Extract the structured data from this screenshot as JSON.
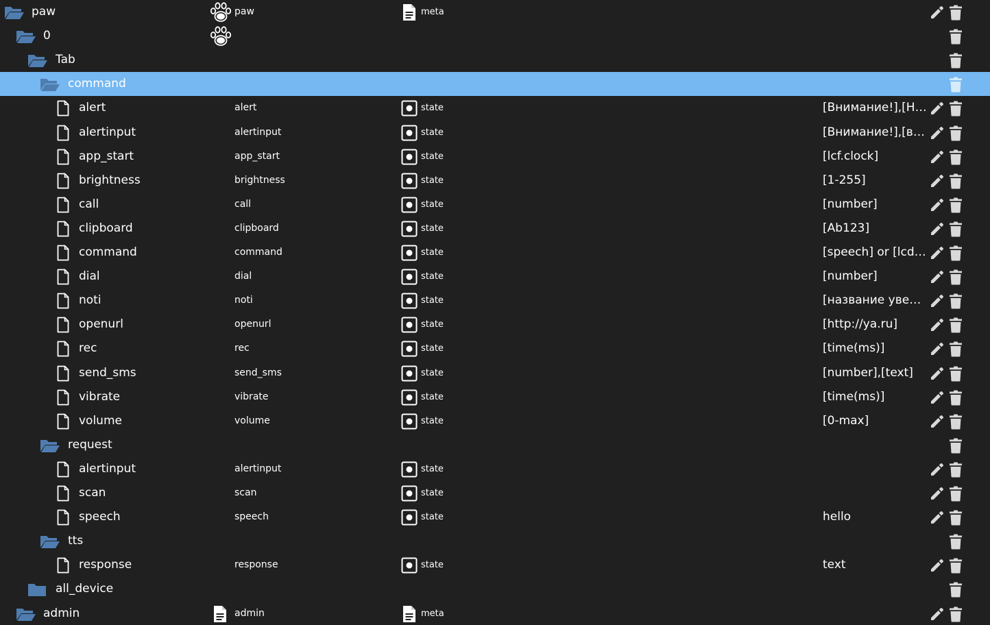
{
  "tree": [
    {
      "type": "folder",
      "open": true,
      "depth": 0,
      "name": "paw",
      "common_icon": "paw-icon",
      "common_name": "paw",
      "role_icon": "file-text-icon",
      "role": "meta",
      "edit": true
    },
    {
      "type": "folder",
      "open": true,
      "depth": 1,
      "name": "0",
      "common_icon": "paw-icon",
      "common_name": "",
      "role": "",
      "edit": false
    },
    {
      "type": "folder",
      "open": true,
      "depth": 2,
      "name": "Tab",
      "role": "",
      "edit": false
    },
    {
      "type": "folder",
      "open": true,
      "depth": 3,
      "name": "command",
      "role": "",
      "edit": false,
      "selected": true
    },
    {
      "type": "state",
      "depth": 4,
      "name": "alert",
      "common_name": "alert",
      "role_icon": "state-icon",
      "role": "state",
      "value": "[Внимание!],[Нет соединения]",
      "edit": true
    },
    {
      "type": "state",
      "depth": 4,
      "name": "alertinput",
      "common_name": "alertinput",
      "role_icon": "state-icon",
      "role": "state",
      "value": "[Внимание!],[введите текст]",
      "edit": true
    },
    {
      "type": "state",
      "depth": 4,
      "name": "app_start",
      "common_name": "app_start",
      "role_icon": "state-icon",
      "role": "state",
      "value": "[lcf.clock]",
      "edit": true
    },
    {
      "type": "state",
      "depth": 4,
      "name": "brightness",
      "common_name": "brightness",
      "role_icon": "state-icon",
      "role": "state",
      "value": "[1-255]",
      "edit": true
    },
    {
      "type": "state",
      "depth": 4,
      "name": "call",
      "common_name": "call",
      "role_icon": "state-icon",
      "role": "state",
      "value": "[number]",
      "edit": true
    },
    {
      "type": "state",
      "depth": 4,
      "name": "clipboard",
      "common_name": "clipboard",
      "role_icon": "state-icon",
      "role": "state",
      "value": "[Ab123]",
      "edit": true
    },
    {
      "type": "state",
      "depth": 4,
      "name": "command",
      "common_name": "command",
      "role_icon": "state-icon",
      "role": "state",
      "value": "[speech] or [lcd_on]",
      "edit": true
    },
    {
      "type": "state",
      "depth": 4,
      "name": "dial",
      "common_name": "dial",
      "role_icon": "state-icon",
      "role": "state",
      "value": "[number]",
      "edit": true
    },
    {
      "type": "state",
      "depth": 4,
      "name": "noti",
      "common_name": "noti",
      "role_icon": "state-icon",
      "role": "state",
      "value": "[название увед.],[текст]",
      "edit": true
    },
    {
      "type": "state",
      "depth": 4,
      "name": "openurl",
      "common_name": "openurl",
      "role_icon": "state-icon",
      "role": "state",
      "value": "[http://ya.ru]",
      "edit": true
    },
    {
      "type": "state",
      "depth": 4,
      "name": "rec",
      "common_name": "rec",
      "role_icon": "state-icon",
      "role": "state",
      "value": "[time(ms)]",
      "edit": true
    },
    {
      "type": "state",
      "depth": 4,
      "name": "send_sms",
      "common_name": "send_sms",
      "role_icon": "state-icon",
      "role": "state",
      "value": "[number],[text]",
      "edit": true
    },
    {
      "type": "state",
      "depth": 4,
      "name": "vibrate",
      "common_name": "vibrate",
      "role_icon": "state-icon",
      "role": "state",
      "value": "[time(ms)]",
      "edit": true
    },
    {
      "type": "state",
      "depth": 4,
      "name": "volume",
      "common_name": "volume",
      "role_icon": "state-icon",
      "role": "state",
      "value": "[0-max]",
      "edit": true
    },
    {
      "type": "folder",
      "open": true,
      "depth": 3,
      "name": "request",
      "role": "",
      "edit": false
    },
    {
      "type": "state",
      "depth": 4,
      "name": "alertinput",
      "common_name": "alertinput",
      "role_icon": "state-icon",
      "role": "state",
      "value": "",
      "edit": true
    },
    {
      "type": "state",
      "depth": 4,
      "name": "scan",
      "common_name": "scan",
      "role_icon": "state-icon",
      "role": "state",
      "value": "",
      "edit": true
    },
    {
      "type": "state",
      "depth": 4,
      "name": "speech",
      "common_name": "speech",
      "role_icon": "state-icon",
      "role": "state",
      "value": "hello",
      "edit": true
    },
    {
      "type": "folder",
      "open": true,
      "depth": 3,
      "name": "tts",
      "role": "",
      "edit": false
    },
    {
      "type": "state",
      "depth": 4,
      "name": "response",
      "common_name": "response",
      "role_icon": "state-icon",
      "role": "state",
      "value": "text",
      "edit": true
    },
    {
      "type": "folder",
      "open": false,
      "depth": 2,
      "name": "all_device",
      "role": "",
      "edit": false
    },
    {
      "type": "folder",
      "open": true,
      "depth": 1,
      "name": "admin",
      "common_icon": "file-text-icon",
      "common_name": "admin",
      "role_icon": "file-text-icon",
      "role": "meta",
      "edit": true
    }
  ],
  "colors": {
    "background": "#202020",
    "selected_row": "#75b8f2",
    "folder": "#4f7db0",
    "text": "#ffffff",
    "action_icon": "#d9d9d9"
  }
}
